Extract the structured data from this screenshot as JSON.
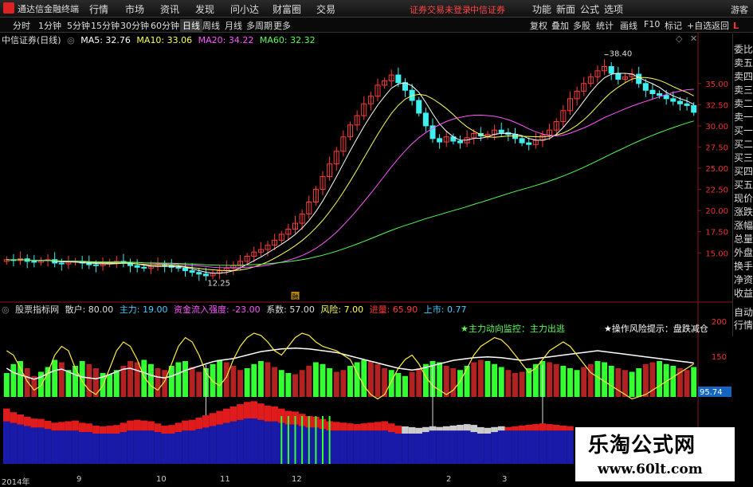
{
  "menu": {
    "app_title": "通达信金融终端",
    "items": [
      "行情",
      "市场",
      "资讯",
      "发现",
      "问小达",
      "财富圈",
      "交易"
    ],
    "notice1": "证券交易未登录",
    "notice2": "中信证券",
    "right_items": [
      "功能",
      "新面",
      "公式",
      "选项"
    ],
    "guest": "游客"
  },
  "periods": [
    "分时",
    "1分钟",
    "5分钟",
    "15分钟",
    "30分钟",
    "60分钟",
    "日线",
    "周线",
    "月线",
    "多周期",
    "更多"
  ],
  "toolbar_right": [
    "复权",
    "叠加",
    "多股",
    "统计",
    "画线",
    "F10",
    "标记",
    "+自选",
    "返回"
  ],
  "legend": {
    "stock": "中信证券(日线)",
    "ma5": "MA5: 32.76",
    "ma10": "MA10: 33.06",
    "ma20": "MA20: 34.22",
    "ma60": "MA60: 32.32"
  },
  "annotations": {
    "high": "38.40",
    "low": "12.25",
    "top_left_char": "L",
    "top_left_sub": "融"
  },
  "price_axis": [
    "35.00",
    "32.50",
    "30.00",
    "27.50",
    "25.00",
    "22.50",
    "20.00",
    "17.50",
    "15.00"
  ],
  "sidebar": [
    "委比",
    "卖五",
    "卖四",
    "卖三",
    "卖二",
    "卖一",
    "买一",
    "买二",
    "买三",
    "买四",
    "买五",
    "现价",
    "涨跌",
    "涨幅",
    "总量",
    "外盘",
    "换手",
    "净资",
    "收益"
  ],
  "sidebar_bottom": [
    "自动",
    "行情"
  ],
  "indicator": {
    "name": "股票指标网",
    "san": "散户: 80.00",
    "zhu": "主力: 19.00",
    "money": "资金流入强度: -23.00",
    "coef": "系数: 57.00",
    "risk": "风险: 7.00",
    "vol": "进量: 65.90",
    "mkt": "上市: 0.77",
    "monitor": "★主力动向监控：主力出逃",
    "hint": "★操作风险提示：盘跌减仓",
    "axis": [
      "200",
      "150"
    ],
    "value_tag": "95.74"
  },
  "dates": [
    "2014年",
    "9",
    "10",
    "11",
    "12",
    "2",
    "3"
  ],
  "watermark": {
    "line1": "乐淘公式网",
    "line2": "www.60lt.com"
  },
  "chart_data": {
    "type": "line",
    "price_ylim": [
      12.25,
      38.4
    ],
    "close": [
      14.2,
      14.1,
      14.3,
      14.0,
      13.9,
      14.1,
      14.2,
      13.8,
      13.7,
      13.9,
      14.0,
      13.8,
      13.6,
      13.5,
      13.7,
      13.9,
      14.0,
      13.8,
      13.5,
      13.3,
      13.2,
      13.4,
      13.6,
      13.5,
      13.3,
      13.2,
      12.9,
      12.7,
      12.5,
      12.3,
      12.6,
      12.9,
      13.2,
      13.5,
      14.0,
      14.6,
      15.1,
      15.4,
      15.9,
      16.5,
      17.2,
      17.8,
      18.5,
      19.6,
      21.0,
      22.5,
      24.0,
      25.5,
      27.0,
      28.7,
      30.1,
      31.2,
      32.6,
      33.5,
      34.8,
      35.3,
      36.0,
      35.1,
      34.2,
      33.0,
      31.5,
      30.0,
      28.5,
      28.1,
      28.7,
      28.2,
      28.0,
      28.6,
      29.1,
      28.8,
      29.0,
      29.5,
      29.2,
      29.0,
      28.5,
      28.0,
      27.8,
      28.3,
      28.9,
      29.5,
      30.5,
      31.8,
      33.2,
      34.1,
      35.0,
      35.8,
      36.5,
      37.0,
      36.2,
      35.5,
      35.8,
      36.1,
      35.0,
      34.2,
      33.8,
      33.6,
      33.2,
      32.9,
      32.6,
      32.4,
      31.6
    ],
    "ma_names": [
      "MA5",
      "MA10",
      "MA20",
      "MA60"
    ],
    "ma_colors": [
      "#ffffff",
      "#ffff55",
      "#ff55ff",
      "#55ff55"
    ],
    "indicator_ylim": [
      0,
      220
    ],
    "osc_bar": [
      40,
      55,
      60,
      48,
      35,
      42,
      50,
      62,
      58,
      45,
      52,
      60,
      55,
      48,
      40,
      38,
      45,
      52,
      60,
      58,
      62,
      55,
      48,
      45,
      52,
      58,
      60,
      50,
      42,
      48,
      55,
      62,
      58,
      52,
      45,
      48,
      55,
      60,
      58,
      50,
      45,
      40,
      38,
      45,
      52,
      58,
      55,
      48,
      42,
      45,
      52,
      58,
      62,
      60,
      55,
      48,
      45,
      40,
      35,
      42,
      48,
      55,
      60,
      58,
      52,
      48,
      45,
      52,
      58,
      62,
      60,
      55,
      50,
      45,
      40,
      42,
      48,
      55,
      60,
      58,
      55,
      52,
      48,
      45,
      50,
      55,
      60,
      58,
      52,
      48,
      45,
      42,
      48,
      55,
      58,
      60,
      55,
      52,
      48,
      45,
      50
    ],
    "osc_sign": [
      1,
      1,
      1,
      -1,
      -1,
      1,
      1,
      1,
      -1,
      1,
      1,
      1,
      -1,
      -1,
      1,
      1,
      1,
      -1,
      -1,
      -1,
      1,
      1,
      -1,
      -1,
      1,
      1,
      1,
      -1,
      -1,
      1,
      1,
      1,
      -1,
      -1,
      -1,
      1,
      1,
      1,
      -1,
      -1,
      1,
      1,
      -1,
      -1,
      -1,
      1,
      1,
      1,
      -1,
      -1,
      1,
      1,
      1,
      -1,
      -1,
      -1,
      1,
      1,
      1,
      -1,
      -1,
      1,
      1,
      1,
      -1,
      -1,
      1,
      1,
      -1,
      -1,
      1,
      1,
      1,
      -1,
      -1,
      -1,
      1,
      1,
      1,
      -1,
      -1,
      1,
      1,
      1,
      -1,
      -1,
      1,
      1,
      1,
      -1,
      -1,
      1,
      1,
      -1,
      -1,
      1,
      1,
      1,
      -1,
      -1,
      1
    ],
    "white_line": [
      120,
      110,
      105,
      100,
      95,
      100,
      108,
      115,
      118,
      112,
      105,
      100,
      98,
      96,
      100,
      106,
      112,
      118,
      120,
      115,
      110,
      104,
      100,
      98,
      102,
      108,
      115,
      120,
      125,
      130,
      135,
      138,
      140,
      142,
      146,
      150,
      154,
      158,
      160,
      162,
      164,
      165,
      166,
      165,
      164,
      162,
      160,
      158,
      156,
      152,
      148,
      144,
      140,
      136,
      132,
      128,
      124,
      120,
      118,
      116,
      118,
      122,
      126,
      130,
      134,
      138,
      140,
      142,
      144,
      145,
      146,
      145,
      144,
      142,
      140,
      138,
      140,
      142,
      144,
      146,
      148,
      150,
      152,
      154,
      156,
      158,
      160,
      158,
      156,
      154,
      152,
      150,
      148,
      146,
      144,
      142,
      140,
      138,
      136,
      134,
      132
    ],
    "yellow_line": [
      160,
      150,
      120,
      90,
      70,
      80,
      110,
      150,
      170,
      160,
      120,
      90,
      70,
      60,
      80,
      120,
      160,
      180,
      170,
      140,
      100,
      80,
      70,
      90,
      130,
      170,
      190,
      180,
      150,
      110,
      90,
      80,
      100,
      140,
      170,
      190,
      200,
      195,
      180,
      160,
      150,
      170,
      190,
      200,
      195,
      180,
      170,
      165,
      160,
      150,
      140,
      110,
      80,
      60,
      50,
      60,
      90,
      120,
      140,
      150,
      130,
      100,
      80,
      70,
      60,
      70,
      90,
      120,
      150,
      170,
      180,
      190,
      185,
      170,
      150,
      130,
      110,
      120,
      140,
      160,
      170,
      180,
      170,
      150,
      130,
      110,
      100,
      90,
      80,
      70,
      60,
      50,
      55,
      60,
      70,
      80,
      90,
      100,
      110,
      120,
      130
    ],
    "flow_top": [
      36,
      30,
      28,
      26,
      25,
      24,
      23,
      22,
      24,
      26,
      28,
      26,
      24,
      22,
      20,
      22,
      24,
      26,
      28,
      30,
      28,
      26,
      24,
      22,
      24,
      26,
      28,
      30,
      32,
      34,
      36,
      38,
      40,
      42,
      44,
      46,
      48,
      46,
      44,
      42,
      40,
      38,
      36,
      34,
      32,
      30,
      28,
      26,
      24,
      22,
      20,
      18,
      20,
      22,
      24,
      26,
      24,
      22,
      20,
      18,
      16,
      14,
      12,
      10,
      12,
      14,
      16,
      18,
      20,
      18,
      16,
      14,
      12,
      10,
      12,
      14,
      16,
      18,
      20,
      18,
      16,
      14,
      12,
      10,
      8,
      6,
      8,
      10,
      12,
      14,
      16,
      14,
      12,
      10,
      8,
      6,
      8,
      10,
      12,
      14,
      12
    ],
    "flow_base": [
      28,
      27,
      26,
      25,
      24,
      24,
      23,
      22,
      22,
      22,
      22,
      21,
      21,
      20,
      20,
      20,
      20,
      21,
      22,
      22,
      22,
      22,
      21,
      20,
      20,
      21,
      22,
      22,
      23,
      24,
      25,
      26,
      27,
      28,
      29,
      30,
      30,
      29,
      28,
      28,
      27,
      26,
      26,
      25,
      24,
      24,
      23,
      22,
      22,
      22,
      22,
      22,
      22,
      22,
      22,
      22,
      21,
      20,
      20,
      20,
      20,
      21,
      22,
      22,
      22,
      22,
      22,
      22,
      21,
      20,
      20,
      21,
      22,
      22,
      22,
      22,
      22,
      22,
      22,
      22,
      22,
      22,
      22,
      22,
      22,
      22,
      22,
      22,
      22,
      22,
      22,
      22,
      22,
      22,
      22,
      22,
      22,
      22,
      22,
      22,
      22
    ]
  }
}
